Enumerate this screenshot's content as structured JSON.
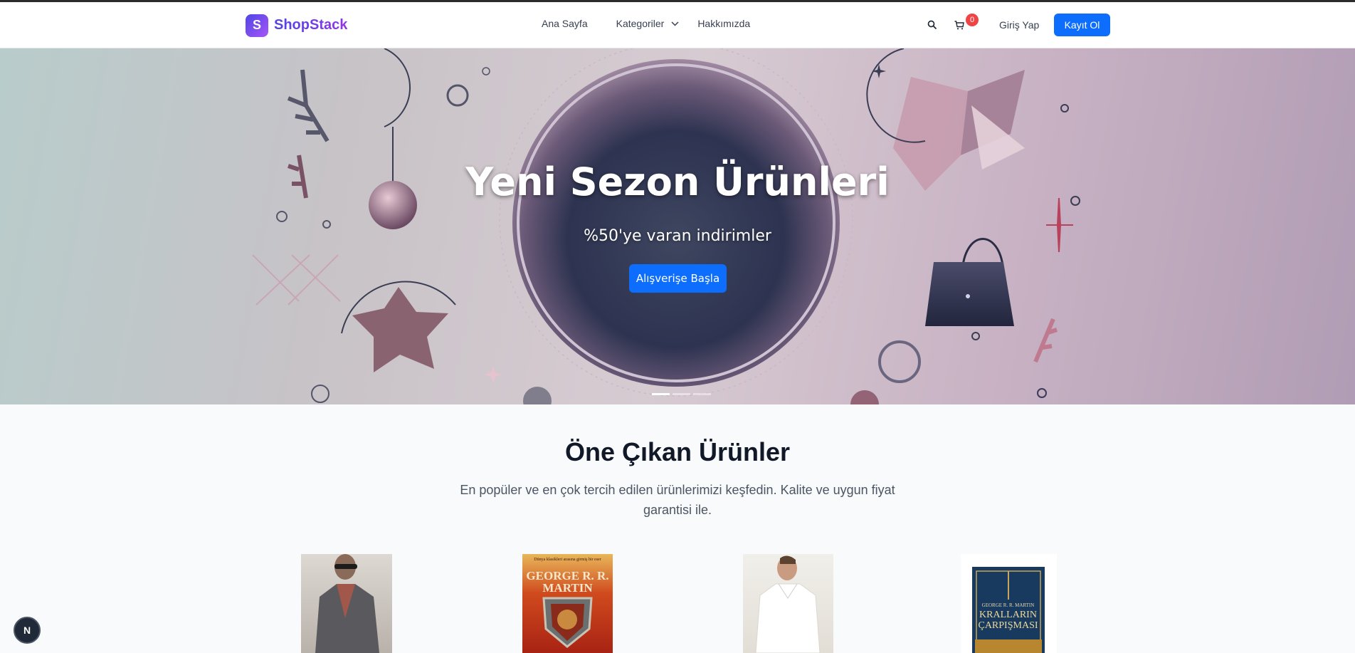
{
  "brand": {
    "letter": "S",
    "name": "ShopStack"
  },
  "nav": {
    "home": "Ana Sayfa",
    "categories": "Kategoriler",
    "about": "Hakkımızda"
  },
  "header": {
    "cart_count": "0",
    "login": "Giriş Yap",
    "register": "Kayıt Ol"
  },
  "hero": {
    "title": "Yeni Sezon Ürünleri",
    "subtitle": "%50'ye varan indirimler",
    "cta": "Alışverişe Başla",
    "slide_count": 3,
    "active_slide": 1
  },
  "featured": {
    "title": "Öne Çıkan Ürünler",
    "description": "En popüler ve en çok tercih edilen ürünlerimizi keşfedin. Kalite ve uygun fiyat garantisi ile."
  },
  "products": {
    "book1": {
      "top_text": "Dünya klasikleri arasına girmiş bir eser",
      "author": "GEORGE R. R. MARTIN"
    },
    "book2": {
      "author": "GEORGE R. R. MARTIN",
      "title": "KRALLARIN ÇARPIŞMASI"
    }
  },
  "dev_badge": "N",
  "colors": {
    "primary": "#0d6efd",
    "brand_from": "#4f46e5",
    "brand_to": "#9333ea",
    "badge": "#ef4444"
  }
}
